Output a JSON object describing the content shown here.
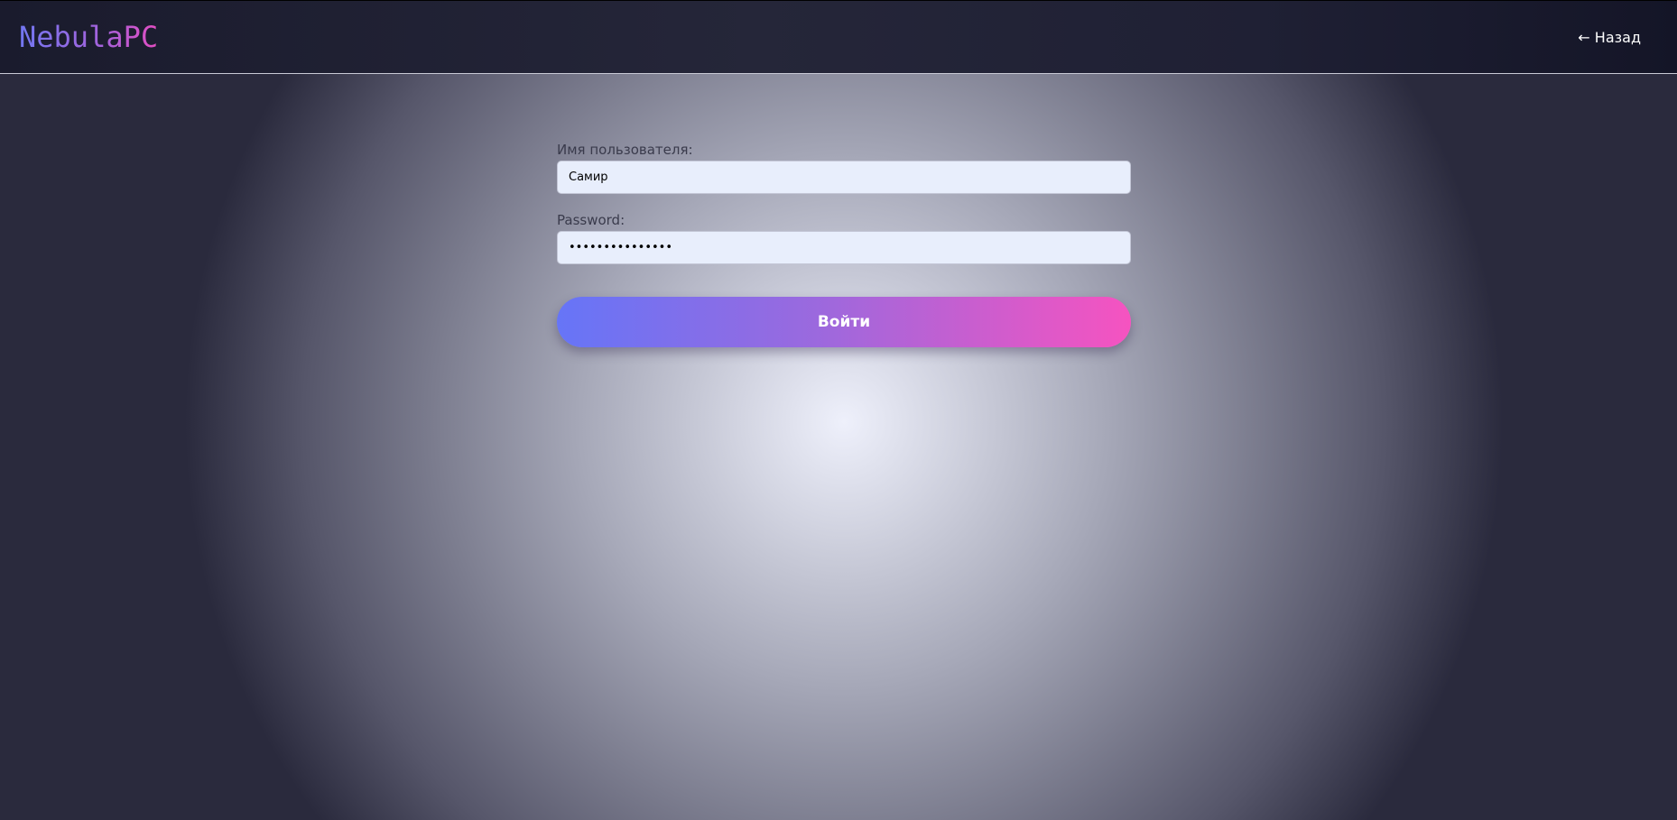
{
  "header": {
    "logo_text": "NebulaPC",
    "back_link_label": "← Назад"
  },
  "login_form": {
    "username": {
      "label": "Имя пользователя:",
      "value": "Самир"
    },
    "password": {
      "label": "Password:",
      "value": "•••••••••••••••"
    },
    "submit_label": "Войти"
  },
  "colors": {
    "logo_gradient_start": "#7277f1",
    "logo_gradient_end": "#e34dc2",
    "button_gradient_start": "#6675f7",
    "button_gradient_end": "#f653c0",
    "input_background": "#e8eefc",
    "header_background": "#1f2034"
  }
}
